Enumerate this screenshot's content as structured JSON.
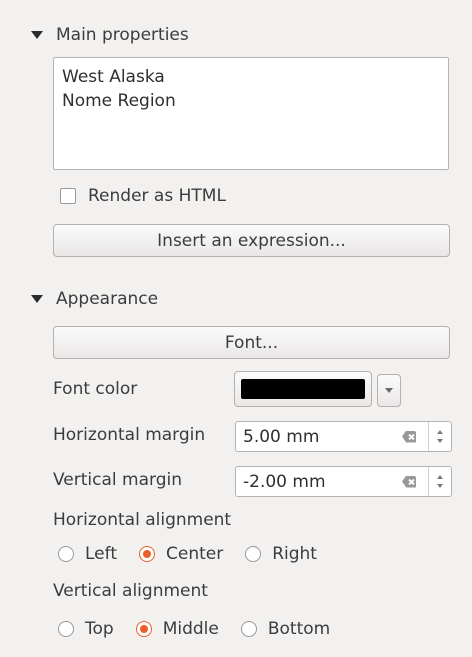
{
  "main_properties": {
    "title": "Main properties",
    "label_text_lines": [
      "West Alaska",
      "Nome Region"
    ],
    "render_html_label": "Render as HTML",
    "render_html_checked": false,
    "insert_expression_label": "Insert an expression..."
  },
  "appearance": {
    "title": "Appearance",
    "font_button_label": "Font...",
    "font_color_label": "Font color",
    "font_color_value": "#000000",
    "horizontal_margin_label": "Horizontal margin",
    "horizontal_margin_value": "5.00 mm",
    "vertical_margin_label": "Vertical margin",
    "vertical_margin_value": "-2.00 mm",
    "horizontal_alignment_label": "Horizontal alignment",
    "horizontal_alignment_options": [
      "Left",
      "Center",
      "Right"
    ],
    "horizontal_alignment_selected": "Center",
    "vertical_alignment_label": "Vertical alignment",
    "vertical_alignment_options": [
      "Top",
      "Middle",
      "Bottom"
    ],
    "vertical_alignment_selected": "Middle"
  },
  "colors": {
    "radio_accent": "#e8602c",
    "background": "#f2f1f0"
  }
}
